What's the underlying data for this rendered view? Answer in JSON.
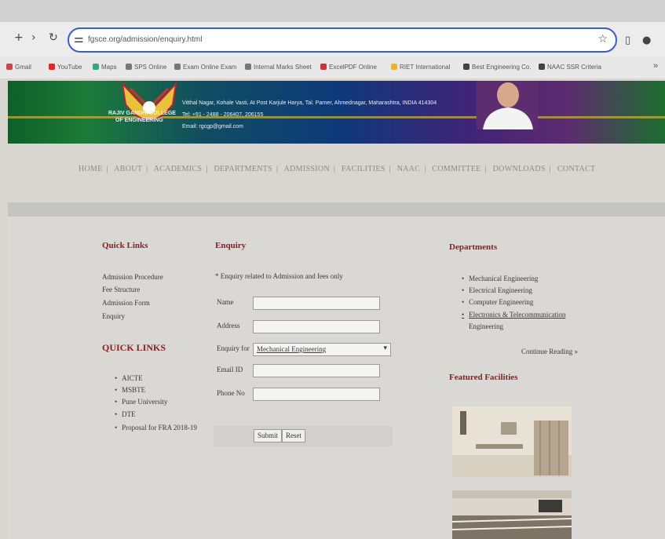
{
  "browser": {
    "tabs": [
      "",
      "",
      "",
      "",
      ""
    ],
    "url": "fgsce.org/admission/enquiry.html",
    "bookmarks": [
      "Gmail",
      "YouTube",
      "Maps",
      "SPS Online",
      "Exam Online Exam",
      "Internal Marks Sheet",
      "ExcelPDF Online",
      "RIET International",
      "Best Engineering Co.",
      "NAAC SSR Criteria"
    ]
  },
  "banner": {
    "college_lines": [
      "RAJIV GANDHI COLLEGE",
      "OF ENGINEERING"
    ],
    "address": "Vitthal Nagar, Kohale Vasti, At Post Karjule Harya, Tal. Parner, Ahmednagar, Maharashtra, INDIA 414304",
    "tel": "Tel: +91 - 2488 - 206407, 206155",
    "email": "Email: rgcgp@gmail.com"
  },
  "menu": [
    "HOME",
    "ABOUT",
    "ACADEMICS",
    "DEPARTMENTS",
    "ADMISSION",
    "FACILITIES",
    "NAAC",
    "COMMITTEE",
    "DOWNLOADS",
    "CONTACT"
  ],
  "left": {
    "quick_links_title": "Quick Links",
    "links": [
      "Admission Procedure",
      "Fee Structure",
      "Admission Form",
      "Enquiry"
    ],
    "quick_links_title2": "QUICK LINKS",
    "bullets": [
      "AICTE",
      "MSBTE",
      "Pune University",
      "DTE",
      "Proposal for FRA 2018-19"
    ]
  },
  "enquiry": {
    "title": "Enquiry",
    "note": "* Enquiry related to Admission and fees only",
    "name_label": "Name",
    "address_label": "Address",
    "enquiry_for_label": "Enquiry for",
    "enquiry_for_value": "Mechanical Engineering",
    "email_label": "Email ID",
    "phone_label": "Phone No",
    "submit": "Submit",
    "reset": "Reset"
  },
  "right": {
    "departments_title": "Departments",
    "departments": [
      "Mechanical Engineering",
      "Electrical Engineering",
      "Computer Engineering",
      "Electronics & Telecommunication",
      "Engineering"
    ],
    "continue_reading": "Continue Reading »",
    "featured_title": "Featured Facilities"
  }
}
